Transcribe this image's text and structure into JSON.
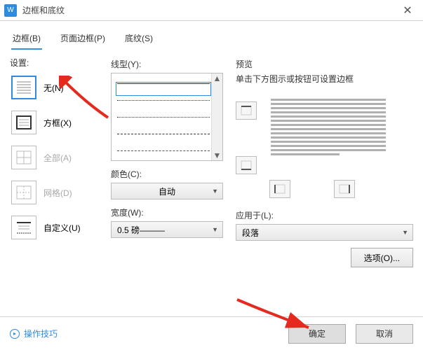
{
  "window": {
    "title": "边框和底纹"
  },
  "tabs": {
    "border": "边框(B)",
    "page": "页面边框(P)",
    "shading": "底纹(S)"
  },
  "settings": {
    "header": "设置:",
    "none": "无(N)",
    "box": "方框(X)",
    "all": "全部(A)",
    "grid": "网格(D)",
    "custom": "自定义(U)"
  },
  "style": {
    "lineLabel": "线型(Y):",
    "colorLabel": "颜色(C):",
    "colorValue": "自动",
    "widthLabel": "宽度(W):",
    "widthValue": "0.5  磅———"
  },
  "preview": {
    "header": "预览",
    "hint": "单击下方图示或按钮可设置边框",
    "applyLabel": "应用于(L):",
    "applyValue": "段落",
    "optionsBtn": "选项(O)..."
  },
  "footer": {
    "tips": "操作技巧",
    "ok": "确定",
    "cancel": "取消"
  }
}
